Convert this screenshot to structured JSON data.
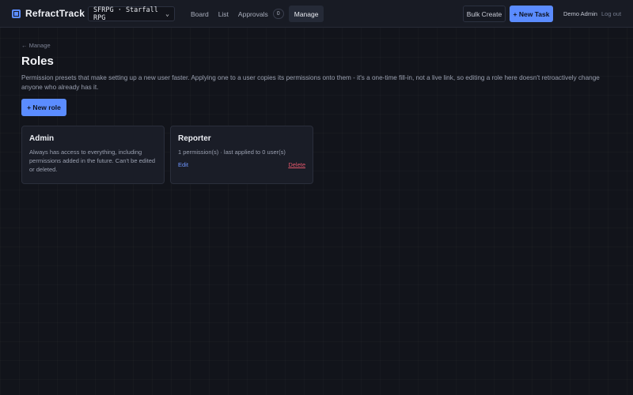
{
  "app": {
    "name": "RefractTrack"
  },
  "header": {
    "project": "SFRPG · Starfall RPG",
    "nav": [
      {
        "label": "Board"
      },
      {
        "label": "List"
      },
      {
        "label": "Approvals",
        "badge": "0"
      },
      {
        "label": "Manage",
        "active": true
      }
    ],
    "bulk_create": "Bulk Create",
    "new_task": "+ New Task",
    "user": "Demo Admin",
    "logout": "Log out"
  },
  "page": {
    "back_link": "← Manage",
    "title": "Roles",
    "description": "Permission presets that make setting up a new user faster. Applying one to a user copies its permissions onto them - it's a one-time fill-in, not a live link, so editing a role here doesn't retroactively change anyone who already has it.",
    "new_role": "+ New role"
  },
  "roles": [
    {
      "name": "Admin",
      "description": "Always has access to everything, including permissions added in the future. Can't be edited or deleted."
    },
    {
      "name": "Reporter",
      "description": "1 permission(s) · last applied to 0 user(s)",
      "edit": "Edit",
      "delete": "Delete"
    }
  ],
  "colors": {
    "accent": "#5b8cff",
    "danger": "#e0566a",
    "background": "#12141b"
  }
}
